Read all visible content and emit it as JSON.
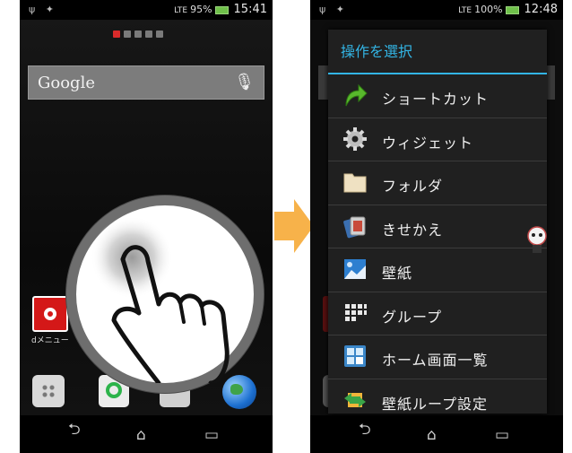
{
  "left_phone": {
    "status": {
      "signal": "LTE",
      "battery": "95%",
      "time": "15:41"
    },
    "page_dots_count": 5,
    "page_dot_active_index": 0,
    "search": {
      "logo_text": "Google",
      "mic_icon": "mic-icon"
    },
    "app_label": "dメニュー",
    "dock_icons": [
      "apps-grid-icon",
      "phone-icon",
      "mail-icon",
      "browser-globe-icon"
    ],
    "gesture": "long-press-hand-icon"
  },
  "arrow_color": "#f7b24a",
  "right_phone": {
    "status": {
      "signal": "LTE",
      "battery": "100%",
      "time": "12:48"
    },
    "dialog": {
      "title": "操作を選択",
      "accent": "#33b5e5",
      "items": [
        {
          "label": "ショートカット",
          "icon": "shortcut-arrow-icon"
        },
        {
          "label": "ウィジェット",
          "icon": "widget-gear-icon"
        },
        {
          "label": "フォルダ",
          "icon": "folder-icon"
        },
        {
          "label": "きせかえ",
          "icon": "theme-icon"
        },
        {
          "label": "壁紙",
          "icon": "wallpaper-icon"
        },
        {
          "label": "グループ",
          "icon": "group-grid-icon"
        },
        {
          "label": "ホーム画面一覧",
          "icon": "home-screens-icon"
        },
        {
          "label": "壁紙ループ設定",
          "icon": "wallpaper-loop-icon"
        }
      ]
    }
  },
  "nav_icons": [
    "back-icon",
    "home-icon",
    "recent-apps-icon"
  ]
}
